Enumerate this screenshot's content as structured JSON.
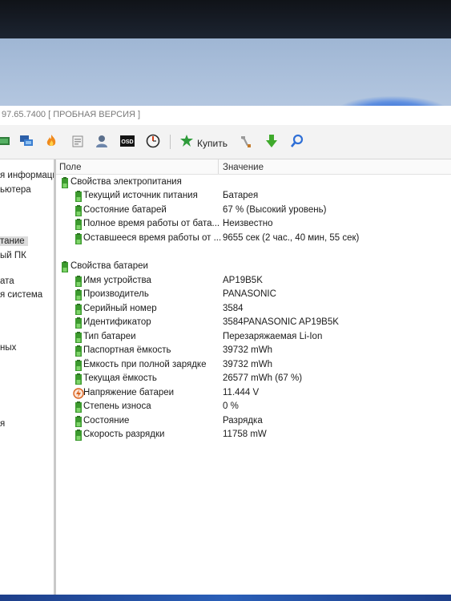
{
  "window": {
    "title": "97.65.7400  [ ПРОБНАЯ ВЕРСИЯ ]"
  },
  "toolbar": {
    "buy_label": "Купить",
    "icons": [
      "chip-icon",
      "network-icon",
      "flame-icon",
      "report-icon",
      "user-icon",
      "osd-icon",
      "gauge-icon",
      "buy-icon",
      "tools-icon",
      "download-icon",
      "search-icon"
    ],
    "osd_text": "OSD"
  },
  "sidebar": {
    "items": [
      {
        "label": "я информаци"
      },
      {
        "label": "ьютера"
      },
      {
        "label": "тание"
      },
      {
        "label": "ый ПК"
      },
      {
        "label": "ата"
      },
      {
        "label": "я система"
      },
      {
        "label": "ных"
      },
      {
        "label": "я"
      }
    ]
  },
  "list": {
    "col_field": "Поле",
    "col_value": "Значение",
    "groups": [
      {
        "label": "Свойства электропитания",
        "rows": [
          {
            "field": "Текущий источник питания",
            "value": "Батарея"
          },
          {
            "field": "Состояние батарей",
            "value": "67 % (Высокий уровень)"
          },
          {
            "field": "Полное время работы от бата...",
            "value": "Неизвестно"
          },
          {
            "field": "Оставшееся время работы от ...",
            "value": "9655 сек (2 час., 40 мин, 55 сек)"
          }
        ]
      },
      {
        "label": "Свойства батареи",
        "rows": [
          {
            "field": "Имя устройства",
            "value": "AP19B5K"
          },
          {
            "field": "Производитель",
            "value": "PANASONIC"
          },
          {
            "field": "Серийный номер",
            "value": "3584"
          },
          {
            "field": "Идентификатор",
            "value": "3584PANASONIC AP19B5K"
          },
          {
            "field": "Тип батареи",
            "value": "Перезаряжаемая Li-Ion"
          },
          {
            "field": "Паспортная ёмкость",
            "value": "39732 mWh"
          },
          {
            "field": "Ёмкость при полной зарядке",
            "value": "39732 mWh"
          },
          {
            "field": "Текущая ёмкость",
            "value": "26577 mWh  (67 %)"
          },
          {
            "field": "Напряжение батареи",
            "value": "11.444 V"
          },
          {
            "field": "Степень износа",
            "value": "0 %"
          },
          {
            "field": "Состояние",
            "value": "Разрядка"
          },
          {
            "field": "Скорость разрядки",
            "value": "11758 mW"
          }
        ]
      }
    ]
  },
  "colors": {
    "battery_icon": "#3c9a2e",
    "voltage_icon": "#d9621e",
    "buy_icon": "#2e9b3a",
    "download_icon": "#3faa2c",
    "search_icon": "#2f6fd6"
  }
}
